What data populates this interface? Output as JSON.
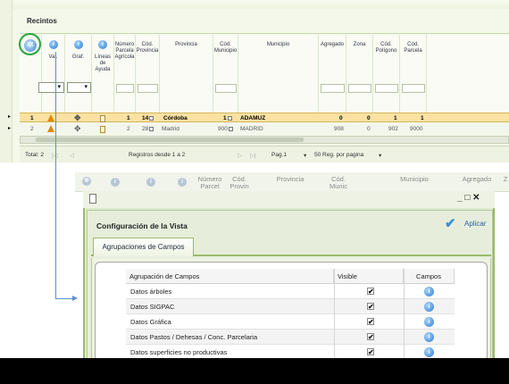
{
  "top_grid": {
    "title": "Recintos",
    "columns": {
      "val": "Val.",
      "graf": "Graf.",
      "lineas": "Líneas de Ayuda",
      "num_parcela": "Número Parcela Agrícola",
      "cod_provincia": "Cód. Provincia",
      "provincia": "Provincia",
      "cod_municipio": "Cód. Municipio",
      "municipio": "Municipio",
      "agregado": "Agregado",
      "zona": "Zona",
      "cod_poligono": "Cód. Polígono",
      "cod_parcela": "Cód. Parcela"
    },
    "rows": [
      {
        "sel": "1",
        "num_parcela": "1",
        "cod_provincia": "14",
        "provincia": "Córdoba",
        "cod_municipio": "1",
        "municipio": "ADAMUZ",
        "agregado": "0",
        "zona": "0",
        "cod_poligono": "1",
        "cod_parcela": "1"
      },
      {
        "sel": "2",
        "num_parcela": "2",
        "cod_provincia": "28",
        "provincia": "Madrid",
        "cod_municipio": "900",
        "municipio": "MADRID",
        "agregado": "908",
        "zona": "0",
        "cod_poligono": "902",
        "cod_parcela": "9000"
      }
    ],
    "pager": {
      "total": "Total: 2",
      "registros": "Registros desde 1 a 2",
      "page": "Pag.1",
      "per_page": "50 Reg. por pagina"
    }
  },
  "bg_grid": {
    "numero": "Número Parcel",
    "cod_provincia": "Cód. Provin",
    "provincia": "Provincia",
    "cod_municipio": "Cód. Munic",
    "municipio": "Municipio",
    "agregado": "Agregado",
    "zona_frag": "Z"
  },
  "dialog": {
    "title": "Configuración de la Vista",
    "apply_label": "Aplicar",
    "tab_label": "Agrupaciones de Campos",
    "table": {
      "headers": {
        "group": "Agrupación de Campos",
        "visible": "Visible",
        "campos": "Campos"
      },
      "rows": [
        {
          "name": "Datos árboles",
          "visible": "✔"
        },
        {
          "name": "Datos SIGPAC",
          "visible": "✔"
        },
        {
          "name": "Datos Gráfica",
          "visible": "✔"
        },
        {
          "name": "Datos Pastos / Dehesas / Conc. Parcelaria",
          "visible": "✔"
        },
        {
          "name": "Datos superficies no productivas",
          "visible": "✔"
        }
      ]
    }
  },
  "window_controls": "_ □ ✕",
  "colors": {
    "selected_row": "#fbe2a2",
    "highlight_circle": "#27a53c",
    "connector": "#5b8fcf",
    "apply_check": "#3b8fd6"
  }
}
